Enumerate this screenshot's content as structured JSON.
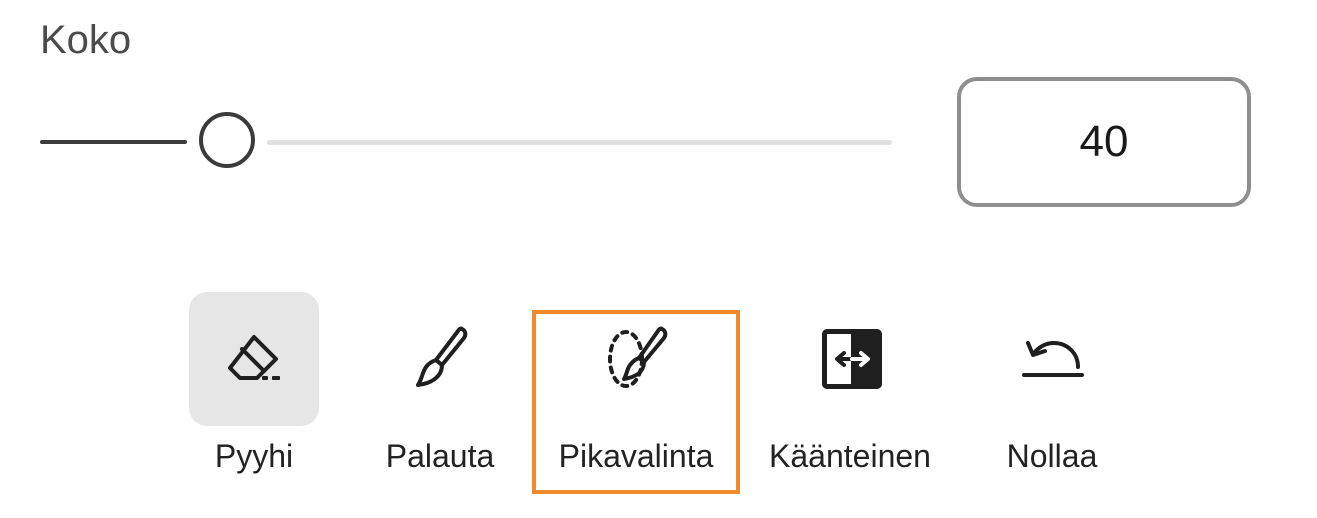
{
  "size_section": {
    "label": "Koko",
    "slider": {
      "value": 40,
      "min": 0,
      "max": 200
    },
    "value_display": "40"
  },
  "tools": [
    {
      "id": "erase",
      "label": "Pyyhi",
      "icon": "eraser-icon",
      "active": true,
      "highlighted": false
    },
    {
      "id": "restore",
      "label": "Palauta",
      "icon": "brush-icon",
      "active": false,
      "highlighted": false
    },
    {
      "id": "quick-select",
      "label": "Pikavalinta",
      "icon": "quick-select-brush-icon",
      "active": false,
      "highlighted": true
    },
    {
      "id": "invert",
      "label": "Käänteinen",
      "icon": "invert-icon",
      "active": false,
      "highlighted": false
    },
    {
      "id": "reset",
      "label": "Nollaa",
      "icon": "reset-icon",
      "active": false,
      "highlighted": false
    }
  ],
  "colors": {
    "highlight": "#f08a2c",
    "active_tool_bg": "#e6e6e6",
    "slider_fill": "#3b3b3b",
    "slider_track": "#e1e1e1"
  }
}
